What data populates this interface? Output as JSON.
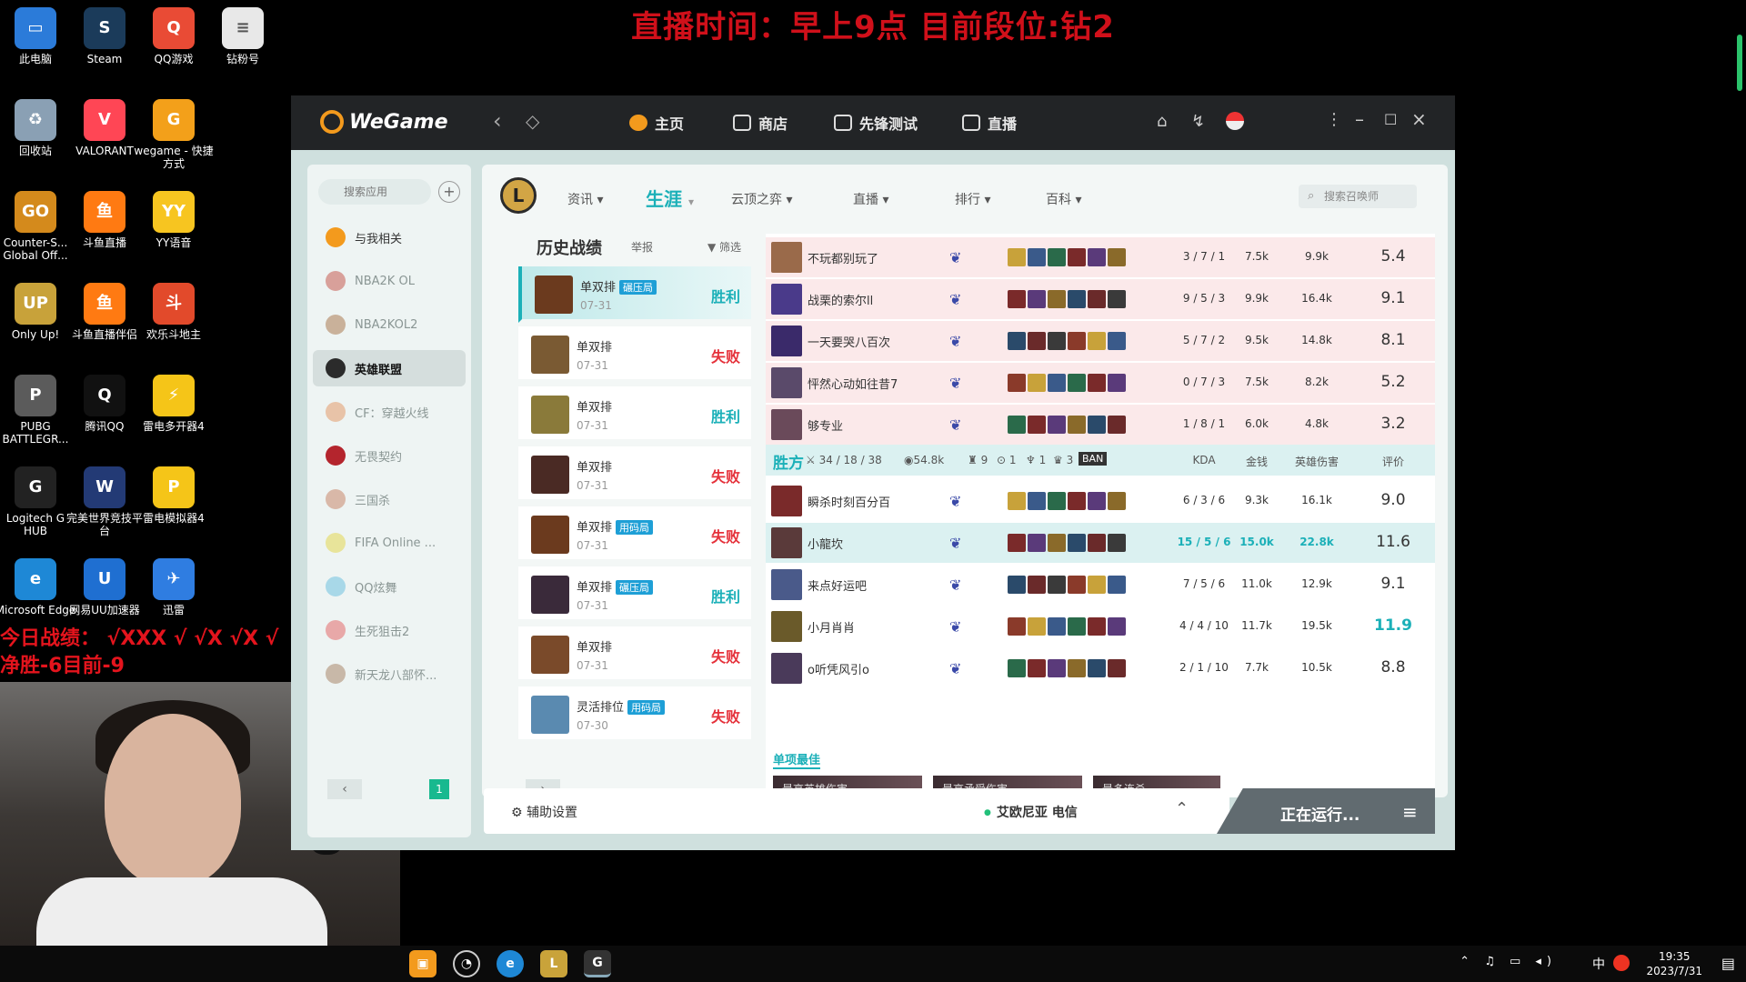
{
  "stream_title": "直播时间：早上9点  目前段位:钻2",
  "overlay": {
    "record_line1": "今日战绩： √XXX √ √X √X √",
    "record_line2": "净胜-6目前-9"
  },
  "desktop_icons": [
    {
      "label": "此电脑",
      "color": "#2b7bd9",
      "glyph": "▭"
    },
    {
      "label": "Steam",
      "color": "#1b3b5a",
      "glyph": "S"
    },
    {
      "label": "QQ游戏",
      "color": "#e94b35",
      "glyph": "Q"
    },
    {
      "label": "钻粉号",
      "color": "#e8e8e8",
      "glyph": "≡"
    },
    {
      "label": "回收站",
      "color": "#8aa0b4",
      "glyph": "♻"
    },
    {
      "label": "VALORANT",
      "color": "#ff4655",
      "glyph": "V"
    },
    {
      "label": "wegame - 快捷方式",
      "color": "#f3a01a",
      "glyph": "G"
    },
    {
      "label": "Counter-S... Global Off...",
      "color": "#d48a1c",
      "glyph": "GO"
    },
    {
      "label": "斗鱼直播",
      "color": "#ff7a12",
      "glyph": "鱼"
    },
    {
      "label": "YY语音",
      "color": "#f7c520",
      "glyph": "YY"
    },
    {
      "label": "Only Up!",
      "color": "#c8a23a",
      "glyph": "UP"
    },
    {
      "label": "斗鱼直播伴侣",
      "color": "#ff7a12",
      "glyph": "鱼"
    },
    {
      "label": "欢乐斗地主",
      "color": "#e24a2b",
      "glyph": "斗"
    },
    {
      "label": "PUBG BATTLEGR...",
      "color": "#5b5b5b",
      "glyph": "P"
    },
    {
      "label": "腾讯QQ",
      "color": "#111111",
      "glyph": "Q"
    },
    {
      "label": "雷电多开器4",
      "color": "#f5c518",
      "glyph": "⚡"
    },
    {
      "label": "Logitech G HUB",
      "color": "#222222",
      "glyph": "G"
    },
    {
      "label": "完美世界竞技平台",
      "color": "#233a75",
      "glyph": "W"
    },
    {
      "label": "雷电模拟器4",
      "color": "#f5c518",
      "glyph": "P"
    },
    {
      "label": "Microsoft Edge",
      "color": "#1e88d6",
      "glyph": "e"
    },
    {
      "label": "网易UU加速器",
      "color": "#1f6fd1",
      "glyph": "U"
    },
    {
      "label": "迅雷",
      "color": "#2f7de1",
      "glyph": "✈"
    }
  ],
  "wegame": {
    "logo": "WeGame",
    "nav": [
      "主页",
      "商店",
      "先锋测试",
      "直播"
    ],
    "sidebar": {
      "search_placeholder": "搜索应用",
      "items": [
        "与我相关",
        "NBA2K OL",
        "NBA2KOL2",
        "英雄联盟",
        "CF：穿越火线",
        "无畏契约",
        "三国杀",
        "FIFA Online ...",
        "QQ炫舞",
        "生死狙击2",
        "新天龙八部怀..."
      ]
    },
    "subnav": [
      "资讯",
      "生涯",
      "云顶之弈",
      "直播",
      "排行",
      "百科"
    ],
    "summoner_search": "搜索召唤师",
    "history": {
      "title": "历史战绩",
      "report": "举报",
      "filter": "筛选",
      "matches": [
        {
          "mode": "单双排",
          "tag": "碾压局",
          "date": "07-31",
          "result": "胜利",
          "win": true,
          "color": "#6b3a1e"
        },
        {
          "mode": "单双排",
          "tag": "",
          "date": "07-31",
          "result": "失败",
          "win": false,
          "color": "#7a5a33"
        },
        {
          "mode": "单双排",
          "tag": "",
          "date": "07-31",
          "result": "胜利",
          "win": true,
          "color": "#8a7a3a"
        },
        {
          "mode": "单双排",
          "tag": "",
          "date": "07-31",
          "result": "失败",
          "win": false,
          "color": "#4a2a24"
        },
        {
          "mode": "单双排",
          "tag": "用码局",
          "date": "07-31",
          "result": "失败",
          "win": false,
          "color": "#6b3a1e"
        },
        {
          "mode": "单双排",
          "tag": "碾压局",
          "date": "07-31",
          "result": "胜利",
          "win": true,
          "color": "#3a2a3a"
        },
        {
          "mode": "单双排",
          "tag": "",
          "date": "07-31",
          "result": "失败",
          "win": false,
          "color": "#7a4a2a"
        },
        {
          "mode": "灵活排位",
          "tag": "用码局",
          "date": "07-30",
          "result": "失败",
          "win": false,
          "color": "#5a8ab0"
        }
      ],
      "page": "1"
    },
    "detail": {
      "losing_team": [
        {
          "name": "不玩都别玩了",
          "kda": "3 / 7 / 1",
          "gold": "7.5k",
          "dmg": "9.9k",
          "score": "5.4",
          "av": "#9a6a4a"
        },
        {
          "name": "战栗的索尔ll",
          "kda": "9 / 5 / 3",
          "gold": "9.9k",
          "dmg": "16.4k",
          "score": "9.1",
          "av": "#4a3a8a"
        },
        {
          "name": "一天要哭八百次",
          "kda": "5 / 7 / 2",
          "gold": "9.5k",
          "dmg": "14.8k",
          "score": "8.1",
          "av": "#3a2a6a"
        },
        {
          "name": "怦然心动如往昔7",
          "kda": "0 / 7 / 3",
          "gold": "7.5k",
          "dmg": "8.2k",
          "score": "5.2",
          "av": "#5a4a6a"
        },
        {
          "name": "够专业",
          "kda": "1 / 8 / 1",
          "gold": "6.0k",
          "dmg": "4.8k",
          "score": "3.2",
          "av": "#6a4a5a"
        }
      ],
      "team_header": {
        "label": "胜方",
        "kills": "34 / 18 / 38",
        "gold": "54.8k",
        "towers": "9",
        "dragons": "1",
        "barons": "1",
        "heralds": "3",
        "ban": "BAN",
        "col_kda": "KDA",
        "col_gold": "金钱",
        "col_dmg": "英雄伤害",
        "col_score": "评价"
      },
      "winning_team": [
        {
          "name": "瞬杀时刻百分百",
          "kda": "6 / 3 / 6",
          "gold": "9.3k",
          "dmg": "16.1k",
          "score": "9.0",
          "av": "#7a2a2a",
          "hl": false
        },
        {
          "name": "小龍坎",
          "kda": "15 / 5 / 6",
          "gold": "15.0k",
          "dmg": "22.8k",
          "score": "11.6",
          "av": "#5a3a3a",
          "hl": true
        },
        {
          "name": "来点好运吧",
          "kda": "7 / 5 / 6",
          "gold": "11.0k",
          "dmg": "12.9k",
          "score": "9.1",
          "av": "#4a5a8a",
          "hl": false
        },
        {
          "name": "小月肖肖",
          "kda": "4 / 4 / 10",
          "gold": "11.7k",
          "dmg": "19.5k",
          "score": "11.9",
          "av": "#6a5a2a",
          "hl": false
        },
        {
          "name": "o听凭风引o",
          "kda": "2 / 1 / 10",
          "gold": "7.7k",
          "dmg": "10.5k",
          "score": "8.8",
          "av": "#4a3a5a",
          "hl": false
        }
      ],
      "best_title": "单项最佳",
      "best_cards": [
        "最高英雄伤害",
        "最高承受伤害",
        "最多连杀"
      ]
    },
    "footer": {
      "assist": "辅助设置",
      "server": "艾欧尼亚 电信",
      "running": "正在运行..."
    }
  },
  "taskbar": {
    "ime": "中",
    "time": "19:35",
    "date": "2023/7/31"
  }
}
